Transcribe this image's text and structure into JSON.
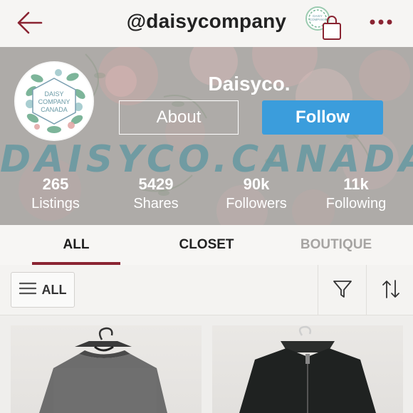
{
  "header": {
    "handle": "@daisycompany"
  },
  "profile": {
    "shop_name": "Daisyco.",
    "about_label": "About",
    "follow_label": "Follow",
    "banner_text": "DAISYCO.CANADA",
    "avatar_text": [
      "DAISY",
      "COMPANY",
      "CANADA"
    ],
    "stats": [
      {
        "value": "265",
        "label": "Listings"
      },
      {
        "value": "5429",
        "label": "Shares"
      },
      {
        "value": "90k",
        "label": "Followers"
      },
      {
        "value": "11k",
        "label": "Following"
      }
    ]
  },
  "tabs": [
    {
      "label": "ALL"
    },
    {
      "label": "CLOSET"
    },
    {
      "label": "BOUTIQUE"
    }
  ],
  "filter": {
    "all_label": "ALL"
  },
  "colors": {
    "accent": "#8a2432",
    "follow": "#3b9ddc"
  },
  "icons": {
    "back": "arrow-left-icon",
    "bag": "shopping-bag-icon",
    "more": "more-dots-icon",
    "menu": "hamburger-icon",
    "filter": "filter-icon",
    "sort": "sort-icon"
  }
}
